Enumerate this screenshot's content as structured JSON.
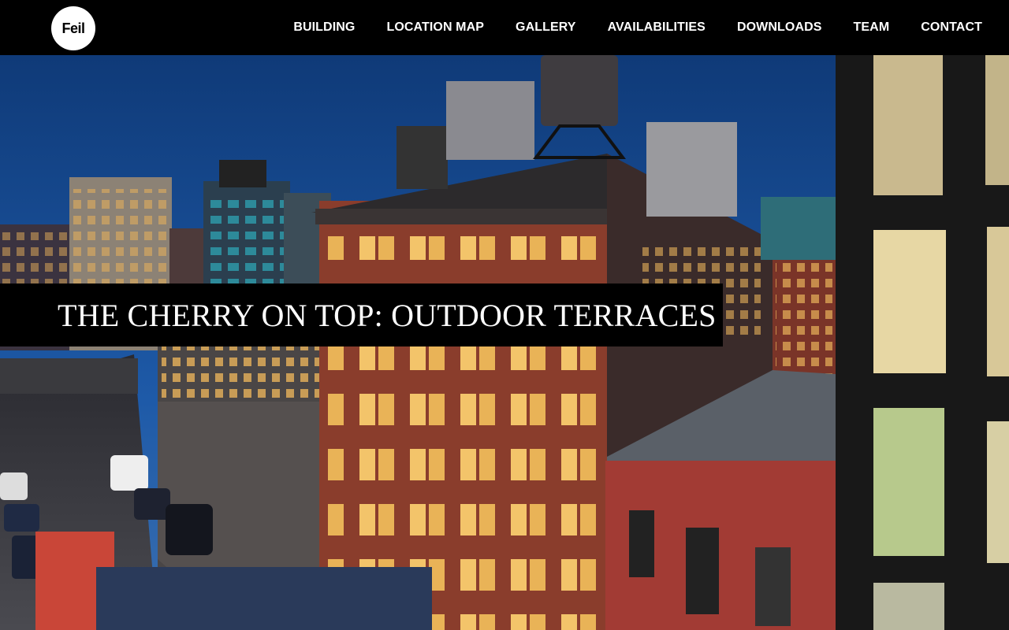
{
  "header": {
    "logo_text": "Feil",
    "nav": [
      {
        "label": "BUILDING"
      },
      {
        "label": "LOCATION MAP"
      },
      {
        "label": "GALLERY"
      },
      {
        "label": "AVAILABILITIES"
      },
      {
        "label": "DOWNLOADS"
      },
      {
        "label": "TEAM"
      },
      {
        "label": "CONTACT"
      }
    ]
  },
  "hero": {
    "headline": "THE CHERRY ON TOP: OUTDOOR TERRACES"
  },
  "colors": {
    "header_bg": "#000000",
    "card_bg": "#2a3a5a",
    "sky": "#1a4a8a"
  }
}
